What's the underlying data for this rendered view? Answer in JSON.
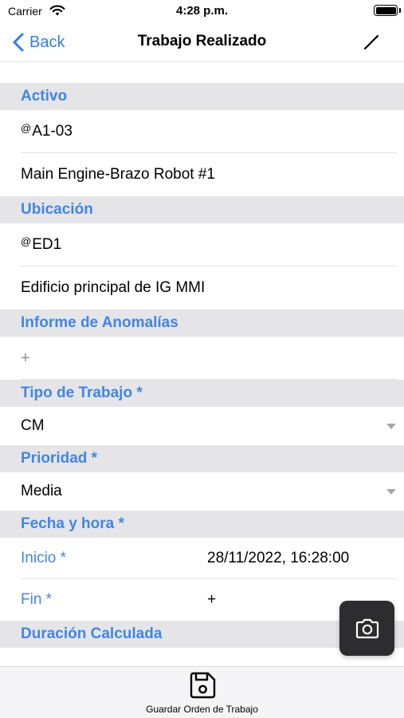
{
  "status_bar": {
    "carrier": "Carrier",
    "time": "4:28 p.m."
  },
  "nav": {
    "back_label": "Back",
    "title": "Trabajo Realizado",
    "edit_icon": "pencil-icon"
  },
  "activo": {
    "header": "Activo",
    "code_prefix": "@",
    "code": "A1-03",
    "description": "Main Engine-Brazo Robot #1"
  },
  "ubicacion": {
    "header": "Ubicación",
    "code_prefix": "@",
    "code": "ED1",
    "description": "Edificio principal de IG MMI"
  },
  "informe": {
    "header": "Informe de Anomalías",
    "add_symbol": "+"
  },
  "tipo_trabajo": {
    "header": "Tipo de Trabajo *",
    "value": "CM"
  },
  "prioridad": {
    "header": "Prioridad *",
    "value": "Media"
  },
  "fecha_hora": {
    "header": "Fecha y hora *",
    "inicio_label": "Inicio *",
    "inicio_value": "28/11/2022, 16:28:00",
    "fin_label": "Fin *",
    "fin_value": "+"
  },
  "duracion": {
    "header": "Duración Calculada"
  },
  "bottom": {
    "save_label": "Guardar Orden de Trabajo",
    "save_icon": "floppy-disk-icon",
    "camera_icon": "camera-icon"
  },
  "colors": {
    "accent": "#3f86e8",
    "link": "#2d7cf6",
    "section_bg": "#e5e5e7",
    "fab_bg": "#2d2d30"
  }
}
